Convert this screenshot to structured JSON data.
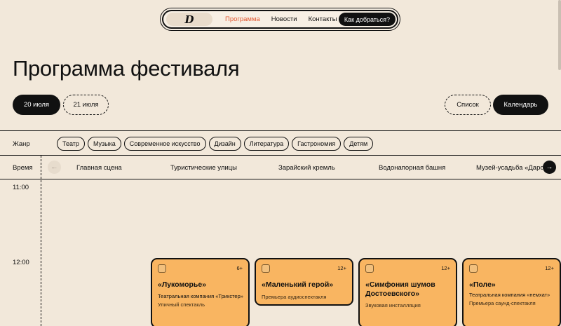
{
  "nav": {
    "logo": "D",
    "links": [
      {
        "label": "Программа",
        "active": true
      },
      {
        "label": "Новости",
        "active": false
      },
      {
        "label": "Контакты",
        "active": false
      }
    ],
    "cta": "Как добраться?"
  },
  "page_title": "Программа фестиваля",
  "dates": [
    {
      "label": "20 июля",
      "selected": true
    },
    {
      "label": "21 июля",
      "selected": false
    }
  ],
  "views": [
    {
      "label": "Список",
      "selected": false
    },
    {
      "label": "Календарь",
      "selected": true
    }
  ],
  "genre": {
    "label": "Жанр",
    "chips": [
      "Театр",
      "Музыка",
      "Современное искусство",
      "Дизайн",
      "Литература",
      "Гастрономия",
      "Детям"
    ]
  },
  "schedule": {
    "time_label": "Время",
    "venues": [
      "Главная сцена",
      "Туристические улицы",
      "Зарайский кремль",
      "Водонапорная башня",
      "Музей-усадьба «Дарово»"
    ],
    "hours": [
      "11:00",
      "12:00"
    ]
  },
  "events": [
    {
      "age": "6+",
      "name": "«Лукоморье»",
      "company": "Театральная компания «Трикстер»",
      "desc": "Уличный спектакль"
    },
    {
      "age": "12+",
      "name": "«Маленький герой»",
      "company": "",
      "desc": "Премьера аудиоспектакля"
    },
    {
      "age": "12+",
      "name": "«Симфония шумов Достоевского»",
      "company": "",
      "desc": "Звуковая инсталляция"
    },
    {
      "age": "12+",
      "name": "«Поле»",
      "company": "Театральная компания «немхат»",
      "desc": "Премьера саунд-спектакля"
    }
  ],
  "colors": {
    "background": "#f2e8da",
    "accent": "#e25a33",
    "card": "#f9b561",
    "dark": "#111111"
  },
  "icons": {
    "prev": "arrow-left-icon",
    "next": "arrow-right-icon",
    "checkbox": "checkbox-icon"
  }
}
